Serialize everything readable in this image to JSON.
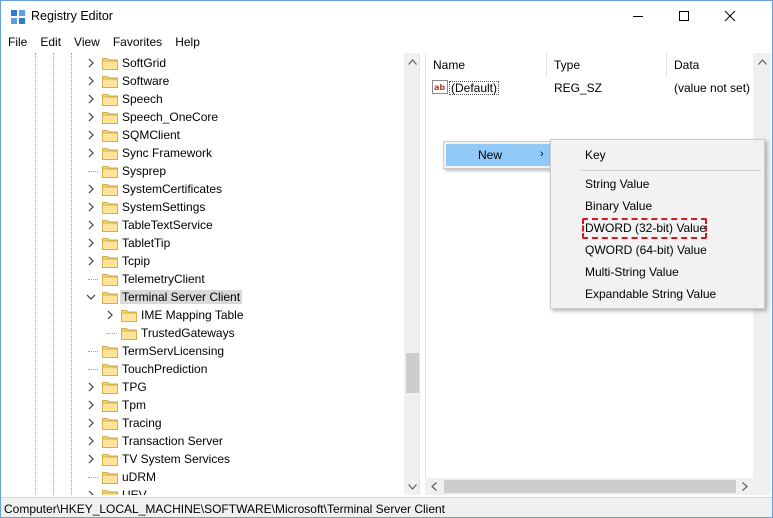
{
  "window": {
    "title": "Registry Editor",
    "icon": "registry-editor-icon"
  },
  "menubar": {
    "items": [
      "File",
      "Edit",
      "View",
      "Favorites",
      "Help"
    ]
  },
  "tree": {
    "items": [
      {
        "label": "SoftGrid",
        "expandable": true
      },
      {
        "label": "Software",
        "expandable": true
      },
      {
        "label": "Speech",
        "expandable": true
      },
      {
        "label": "Speech_OneCore",
        "expandable": true
      },
      {
        "label": "SQMClient",
        "expandable": true
      },
      {
        "label": "Sync Framework",
        "expandable": true
      },
      {
        "label": "Sysprep",
        "expandable": false
      },
      {
        "label": "SystemCertificates",
        "expandable": true
      },
      {
        "label": "SystemSettings",
        "expandable": true
      },
      {
        "label": "TableTextService",
        "expandable": true
      },
      {
        "label": "TabletTip",
        "expandable": true
      },
      {
        "label": "Tcpip",
        "expandable": true
      },
      {
        "label": "TelemetryClient",
        "expandable": false
      },
      {
        "label": "Terminal Server Client",
        "expandable": true,
        "expanded": true,
        "selected": true
      },
      {
        "label": "IME Mapping Table",
        "expandable": true,
        "child": true
      },
      {
        "label": "TrustedGateways",
        "expandable": false,
        "child": true
      },
      {
        "label": "TermServLicensing",
        "expandable": false
      },
      {
        "label": "TouchPrediction",
        "expandable": false
      },
      {
        "label": "TPG",
        "expandable": true
      },
      {
        "label": "Tpm",
        "expandable": true
      },
      {
        "label": "Tracing",
        "expandable": true
      },
      {
        "label": "Transaction Server",
        "expandable": true
      },
      {
        "label": "TV System Services",
        "expandable": true
      },
      {
        "label": "uDRM",
        "expandable": false
      },
      {
        "label": "UEV",
        "expandable": true
      }
    ]
  },
  "values": {
    "columns": {
      "name": "Name",
      "type": "Type",
      "data": "Data"
    },
    "rows": [
      {
        "name": "(Default)",
        "type": "REG_SZ",
        "data": "(value not set)",
        "icon": "string-value-icon"
      }
    ]
  },
  "context_menu": {
    "new_label": "New",
    "submenu": {
      "items": [
        {
          "label": "Key"
        },
        {
          "label": "String Value"
        },
        {
          "label": "Binary Value"
        },
        {
          "label": "DWORD (32-bit) Value",
          "highlighted": true
        },
        {
          "label": "QWORD (64-bit) Value"
        },
        {
          "label": "Multi-String Value"
        },
        {
          "label": "Expandable String Value"
        }
      ]
    }
  },
  "statusbar": {
    "path": "Computer\\HKEY_LOCAL_MACHINE\\SOFTWARE\\Microsoft\\Terminal Server Client"
  },
  "colors": {
    "menu_hover": "#91c9f7",
    "selection": "#d9d9d9",
    "annotation": "#e0141e",
    "folder": "#f5d67a"
  }
}
